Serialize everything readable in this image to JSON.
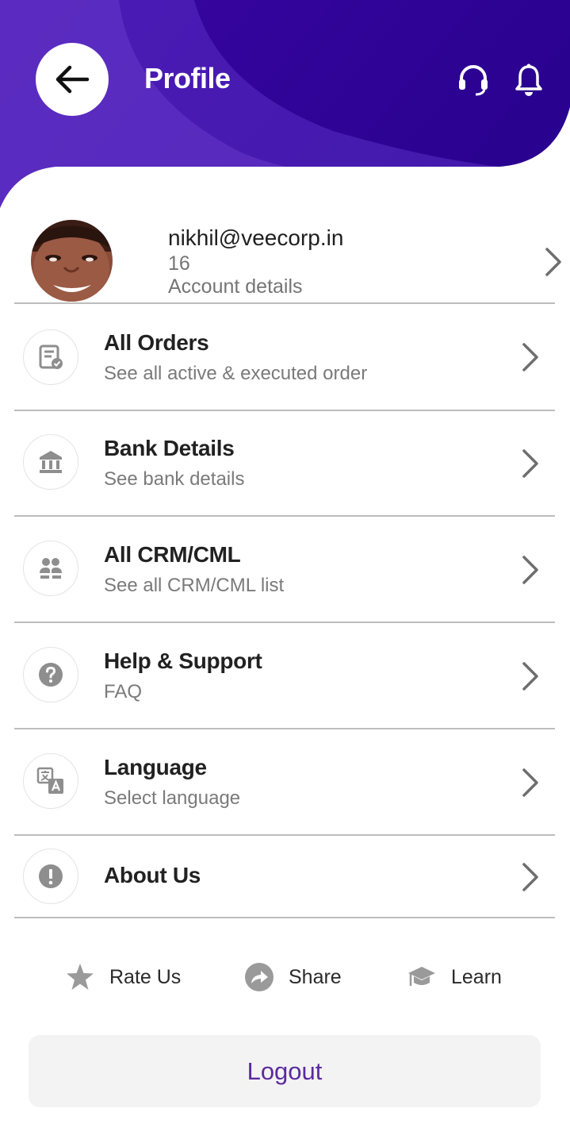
{
  "header": {
    "title": "Profile",
    "back_icon": "arrow-left-icon",
    "support_icon": "headset-icon",
    "notification_icon": "bell-icon",
    "colors": {
      "primary_dark": "#2c0396",
      "primary_light": "#6a3bd2",
      "accent_text": "#5b2a9e"
    }
  },
  "account": {
    "email": "nikhil@veecorp.in",
    "number": "16",
    "subtitle": "Account details"
  },
  "menu": [
    {
      "title": "All Orders",
      "subtitle": "See all active & executed order",
      "icon": "orders-icon"
    },
    {
      "title": "Bank Details",
      "subtitle": "See bank details",
      "icon": "bank-icon"
    },
    {
      "title": "All CRM/CML",
      "subtitle": "See all CRM/CML list",
      "icon": "people-icon"
    },
    {
      "title": "Help & Support",
      "subtitle": "FAQ",
      "icon": "help-icon"
    },
    {
      "title": "Language",
      "subtitle": "Select language",
      "icon": "translate-icon"
    },
    {
      "title": "About Us",
      "subtitle": "",
      "icon": "info-icon"
    }
  ],
  "actions": [
    {
      "label": "Rate Us",
      "icon": "star-icon"
    },
    {
      "label": "Share",
      "icon": "share-icon"
    },
    {
      "label": "Learn",
      "icon": "graduation-cap-icon"
    }
  ],
  "logout": {
    "label": "Logout"
  }
}
